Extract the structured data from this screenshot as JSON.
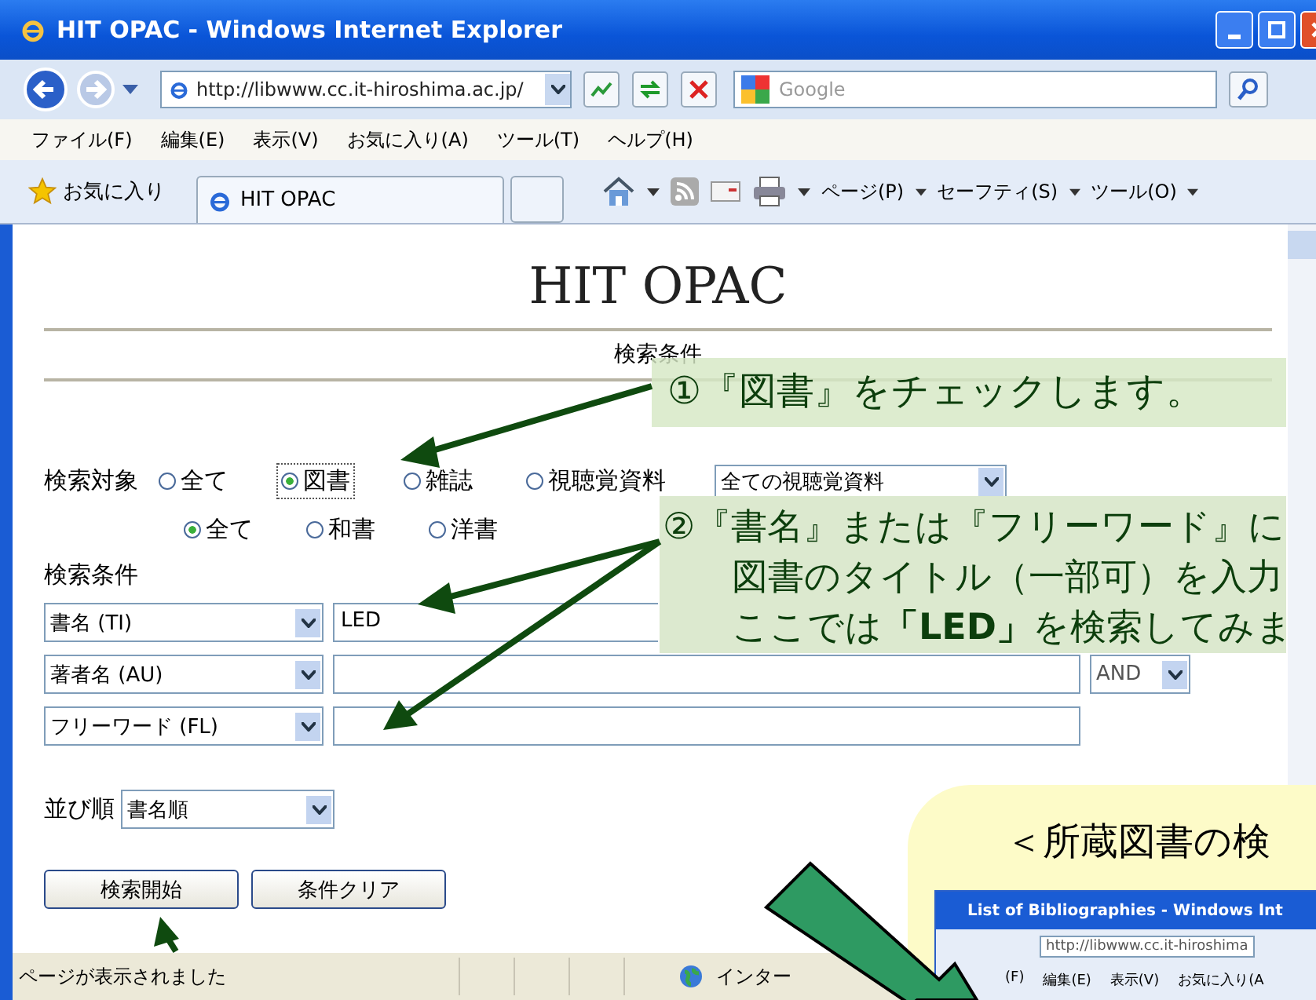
{
  "window": {
    "title": "HIT OPAC - Windows Internet Explorer"
  },
  "address_bar": {
    "url": "http://libwww.cc.it-hiroshima.ac.jp/"
  },
  "search_box": {
    "placeholder": "Google"
  },
  "menu": [
    "ファイル(F)",
    "編集(E)",
    "表示(V)",
    "お気に入り(A)",
    "ツール(T)",
    "ヘルプ(H)"
  ],
  "favorites_bar": {
    "favorites": "お気に入り",
    "tabs": [
      {
        "label": "HIT OPAC",
        "selected": true
      }
    ],
    "commands": [
      "ページ(P)",
      "セーフティ(S)",
      "ツール(O)"
    ]
  },
  "page": {
    "title": "HIT OPAC",
    "section": "検索条件",
    "target_label": "検索対象",
    "target_options": [
      {
        "label": "全て",
        "selected": false
      },
      {
        "label": "図書",
        "selected": true
      },
      {
        "label": "雑誌",
        "selected": false
      },
      {
        "label": "視聴覚資料",
        "selected": false
      }
    ],
    "media_select": "全ての視聴覚資料",
    "language_options": [
      {
        "label": "全て",
        "selected": true
      },
      {
        "label": "和書",
        "selected": false
      },
      {
        "label": "洋書",
        "selected": false
      }
    ],
    "conditions_label": "検索条件",
    "conditions": [
      {
        "field": "書名 (TI)",
        "value": "LED"
      },
      {
        "field": "著者名 (AU)",
        "operator": "AND"
      },
      {
        "field": "フリーワード (FL)"
      }
    ],
    "sort_label": "並び順",
    "sort_select": "書名順",
    "buttons": [
      "検索開始",
      "条件クリア"
    ]
  },
  "status_bar": {
    "text": "ページが表示されました",
    "zone": "インター"
  },
  "callouts": [
    {
      "lines": [
        "①『図書』をチェックします。"
      ]
    },
    {
      "lines": [
        "②『書名』または『フリーワード』に",
        "図書のタイトル（一部可）を入力",
        "ここでは**「LED」**を検索してみま"
      ]
    }
  ],
  "inset": {
    "heading": "＜所蔵図書の検",
    "window_title": "List of Bibliographies - Windows Int",
    "url": "http://libwww.cc.it-hiroshima",
    "menu": [
      "(F)",
      "編集(E)",
      "表示(V)",
      "お気に入り(A"
    ]
  }
}
